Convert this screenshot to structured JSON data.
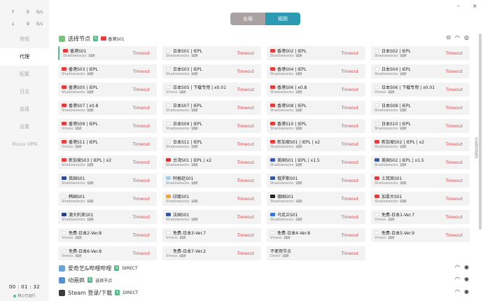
{
  "sidebar": {
    "upload": {
      "arrow": "↑",
      "value": "0",
      "unit": "B/s"
    },
    "download": {
      "arrow": "↓",
      "value": "0",
      "unit": "B/s"
    },
    "items": [
      {
        "label": "常规",
        "active": false
      },
      {
        "label": "代理",
        "active": true
      },
      {
        "label": "配置",
        "active": false
      },
      {
        "label": "日志",
        "active": false
      },
      {
        "label": "连接",
        "active": false
      },
      {
        "label": "设置",
        "active": false
      },
      {
        "label": "iKuuu VPN",
        "active": false
      }
    ],
    "clock": "00 : 01 : 32",
    "status": "核心已运行"
  },
  "window": {
    "minimize": "–",
    "close": "×"
  },
  "mode": {
    "global": "全局",
    "rule": "规则"
  },
  "groups": {
    "select": {
      "title": "选择节点",
      "badge": "S",
      "current": "香港S01"
    },
    "iqiyi": {
      "title": "爱奇艺&哔哩哔哩",
      "badge": "S",
      "current": "DIRECT"
    },
    "anime": {
      "title": "动画疯",
      "badge": "S",
      "current": "选择节点"
    },
    "steam": {
      "title": "Steam 登录/下载",
      "badge": "S",
      "current": "DIRECT"
    }
  },
  "side_tip": "点击测试延迟",
  "colors": {
    "accent": "#2d9ab3",
    "timeout": "#e0474c",
    "badge": "#55bb88"
  },
  "nodes": [
    {
      "name": "香港S01",
      "type": "Shadowsocks",
      "delay": "Timeout",
      "flag": "hk"
    },
    {
      "name": "日本S01 | IEPL",
      "type": "Shadowsocks",
      "delay": "Timeout",
      "flag": "jp"
    },
    {
      "name": "香港S02 | IEPL",
      "type": "Shadowsocks",
      "delay": "Timeout",
      "flag": "hk"
    },
    {
      "name": "日本S02 | IEPL",
      "type": "Shadowsocks",
      "delay": "Timeout",
      "flag": "jp"
    },
    {
      "name": "香港S03 | IEPL",
      "type": "Shadowsocks",
      "delay": "Timeout",
      "flag": "hk"
    },
    {
      "name": "日本S03 | IEPL",
      "type": "Shadowsocks",
      "delay": "Timeout",
      "flag": "jp"
    },
    {
      "name": "香港S04 | IEPL",
      "type": "Shadowsocks",
      "delay": "Timeout",
      "flag": "hk"
    },
    {
      "name": "日本S04 | IEPL",
      "type": "Shadowsocks",
      "delay": "Timeout",
      "flag": "jp"
    },
    {
      "name": "香港S05 | IEPL",
      "type": "Shadowsocks",
      "delay": "Timeout",
      "flag": "hk"
    },
    {
      "name": "日本S05 | 下载专用 | x0.01",
      "type": "Vmess",
      "delay": "Timeout",
      "flag": "jp"
    },
    {
      "name": "香港S06 | x0.8",
      "type": "Shadowsocks",
      "delay": "Timeout",
      "flag": "hk"
    },
    {
      "name": "日本S06 | 下载专用 | x0.01",
      "type": "Vmess",
      "delay": "Timeout",
      "flag": "jp"
    },
    {
      "name": "香港S07 | x0.8",
      "type": "Shadowsocks",
      "delay": "Timeout",
      "flag": "hk"
    },
    {
      "name": "日本S07 | IEPL",
      "type": "Shadowsocks",
      "delay": "Timeout",
      "flag": "jp"
    },
    {
      "name": "香港S08 | IEPL",
      "type": "Shadowsocks",
      "delay": "Timeout",
      "flag": "hk"
    },
    {
      "name": "日本S08 | IEPL",
      "type": "Shadowsocks",
      "delay": "Timeout",
      "flag": "jp"
    },
    {
      "name": "香港S09 | IEPL",
      "type": "Vmess",
      "delay": "Timeout",
      "flag": "hk"
    },
    {
      "name": "日本S09 | IEPL",
      "type": "Shadowsocks",
      "delay": "Timeout",
      "flag": "jp"
    },
    {
      "name": "香港S10 | IEPL",
      "type": "Shadowsocks",
      "delay": "Timeout",
      "flag": "hk"
    },
    {
      "name": "日本S10 | IEPL",
      "type": "Shadowsocks",
      "delay": "Timeout",
      "flag": "jp"
    },
    {
      "name": "香港S11 | IEPL",
      "type": "Vmess",
      "delay": "Timeout",
      "flag": "hk"
    },
    {
      "name": "日本S11 | IEPL",
      "type": "Shadowsocks",
      "delay": "Timeout",
      "flag": "jp"
    },
    {
      "name": "新加坡S01 | IEPL | x2",
      "type": "Shadowsocks",
      "delay": "Timeout",
      "flag": "sg"
    },
    {
      "name": "新加坡S02 | IEPL | x2",
      "type": "Shadowsocks",
      "delay": "Timeout",
      "flag": "sg"
    },
    {
      "name": "新加坡S03 | IEPL | x2",
      "type": "Shadowsocks",
      "delay": "Timeout",
      "flag": "sg"
    },
    {
      "name": "台湾S01 | IEPL | x2",
      "type": "Shadowsocks",
      "delay": "Timeout",
      "flag": "tw"
    },
    {
      "name": "美国S01 | IEPL | x1.5",
      "type": "Shadowsocks",
      "delay": "Timeout",
      "flag": "us"
    },
    {
      "name": "美国S02 | IEPL | x1.5",
      "type": "Shadowsocks",
      "delay": "Timeout",
      "flag": "us"
    },
    {
      "name": "英国S01",
      "type": "Shadowsocks",
      "delay": "Timeout",
      "flag": "uk"
    },
    {
      "name": "阿根廷S01",
      "type": "Shadowsocks",
      "delay": "Timeout",
      "flag": "ar"
    },
    {
      "name": "俄罗斯S01",
      "type": "Shadowsocks",
      "delay": "Timeout",
      "flag": "ru"
    },
    {
      "name": "土耳其S01",
      "type": "Shadowsocks",
      "delay": "Timeout",
      "flag": "tr"
    },
    {
      "name": "韩国S01",
      "type": "Shadowsocks",
      "delay": "Timeout",
      "flag": "kr"
    },
    {
      "name": "印度S01",
      "type": "Shadowsocks",
      "delay": "Timeout",
      "flag": "in"
    },
    {
      "name": "德国S01",
      "type": "Shadowsocks",
      "delay": "Timeout",
      "flag": "de"
    },
    {
      "name": "加拿大S01",
      "type": "Shadowsocks",
      "delay": "Timeout",
      "flag": "ca"
    },
    {
      "name": "澳大利亚S01",
      "type": "Shadowsocks",
      "delay": "Timeout",
      "flag": "au"
    },
    {
      "name": "法国S01",
      "type": "Shadowsocks",
      "delay": "Timeout",
      "flag": "fr"
    },
    {
      "name": "乌克兰S01",
      "type": "Shadowsocks",
      "delay": "Timeout",
      "flag": "ua"
    },
    {
      "name": "免费-日本1-Ver.7",
      "type": "Vmess",
      "delay": "Timeout",
      "flag": "jp"
    },
    {
      "name": "免费-日本2-Ver.8",
      "type": "Vmess",
      "delay": "Timeout",
      "flag": "jp"
    },
    {
      "name": "免费-日本3-Ver.7",
      "type": "Vmess",
      "delay": "Timeout",
      "flag": "jp"
    },
    {
      "name": "免费-日本4-Ver.8",
      "type": "Vmess",
      "delay": "Timeout",
      "flag": "jp"
    },
    {
      "name": "免费-日本5-Ver.9",
      "type": "Vmess",
      "delay": "Timeout",
      "flag": "jp"
    },
    {
      "name": "免费-日本6-Ver.8",
      "type": "Vmess",
      "delay": "Timeout",
      "flag": "jp"
    },
    {
      "name": "免费-日本7-Ver.2",
      "type": "Vmess",
      "delay": "Timeout",
      "flag": "jp"
    },
    {
      "name": "不使用节点",
      "type": "Direct",
      "delay": "Timeout",
      "flag": ""
    }
  ],
  "udp_label": "UDP"
}
